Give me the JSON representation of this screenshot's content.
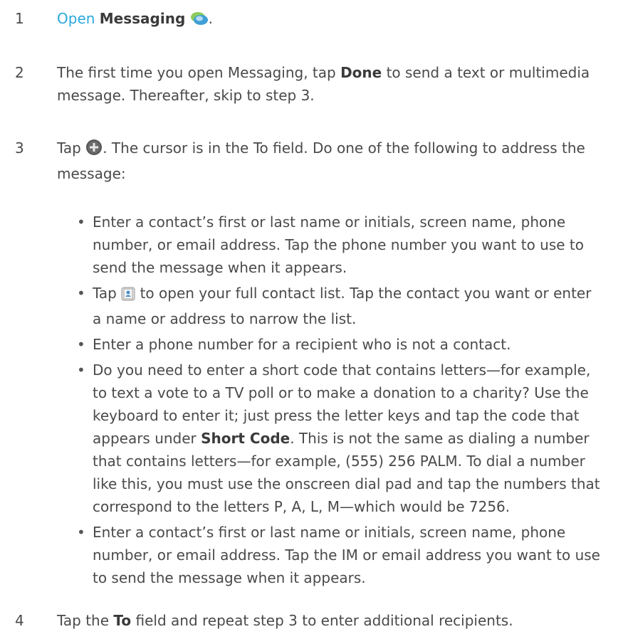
{
  "steps": [
    {
      "num": "1",
      "link": "Open",
      "bold": "Messaging",
      "end": "."
    },
    {
      "num": "2",
      "pre": "The first time you open Messaging, tap ",
      "bold": "Done",
      "post": " to send a text or multimedia message. Thereafter, skip to step 3."
    },
    {
      "num": "3",
      "pre": "Tap ",
      "post": ". The cursor is in the To field. Do one of the following to address the message:"
    },
    {
      "num": "4",
      "pre": "Tap the ",
      "bold": "To",
      "post": " field and repeat step 3 to enter additional recipients."
    }
  ],
  "bullets": {
    "b1": "Enter a contact’s first or last name or initials, screen name, phone number, or email address. Tap the phone number you want to use to send the message when it appears.",
    "b2_pre": "Tap ",
    "b2_post": " to open your full contact list. Tap the contact you want or enter a name or address to narrow the list.",
    "b3": "Enter a phone number for a recipient who is not a contact.",
    "b4_pre": "Do you need to enter a short code that contains letters—for example, to text a vote to a TV poll or to make a donation to a charity? Use the keyboard to enter it; just press the letter keys and tap the code that appears under ",
    "b4_bold": "Short Code",
    "b4_post": ". This is not the same as dialing a number that contains letters—for example, (555) 256 PALM. To dial a number like this, you must use the onscreen dial pad and tap the numbers that correspond to the letters P, A, L, M—which would be 7256.",
    "b5": "Enter a contact’s first or last name or initials, screen name, phone number, or email address. Tap the IM or email address you want to use to send the message when it appears."
  },
  "icons": [
    "messaging-icon",
    "new-message-icon",
    "contacts-icon"
  ]
}
